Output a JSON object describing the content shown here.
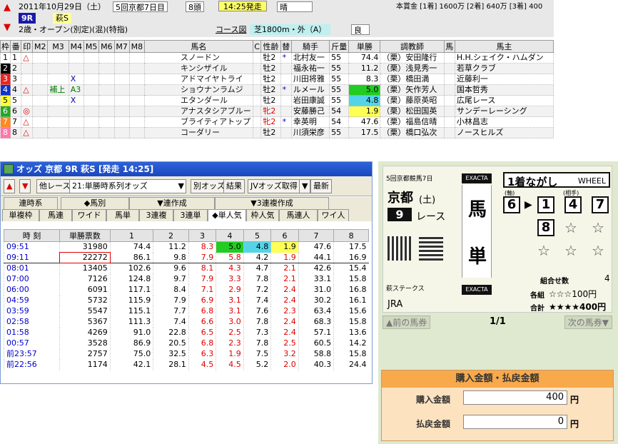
{
  "header": {
    "date": "2011年10月29日（土）",
    "meeting": "5回京都7日目",
    "runners": "8頭",
    "start_time": "14:25発走",
    "weather": "晴",
    "race_no": "9R",
    "race_name": "萩S",
    "conditions": "2歳・オープン(別定)(混)(特指)",
    "course_label": "コース図",
    "course": "芝1800m・外（A）",
    "going": "良",
    "prize": "本賞金 [1着] 1600万 [2着] 640万 [3着] 400"
  },
  "entries": {
    "columns": [
      "枠",
      "番",
      "印",
      "M2",
      "M3",
      "M4",
      "M5",
      "M6",
      "M7",
      "M8",
      "馬名",
      "C",
      "性齢",
      "替",
      "騎手",
      "斤量",
      "単勝",
      "調教師",
      "馬",
      "馬主"
    ],
    "rows": [
      {
        "waku": "1",
        "waku_color": "#ffffff",
        "waku_text": "#000000",
        "no": "1",
        "mark": "△",
        "m2": "",
        "m3": "",
        "m4": "",
        "m5": "",
        "m6": "",
        "name": "スノードン",
        "sex": "牡2",
        "sex_f": false,
        "sw": "*",
        "jockey": "北村友一",
        "kin": "55",
        "odds": "74.4",
        "odds_bg": "",
        "trainer": "（栗）安田隆行",
        "owner": "H.H.シェイク・ハムダン"
      },
      {
        "waku": "2",
        "waku_color": "#000000",
        "waku_text": "#ffffff",
        "no": "2",
        "mark": "",
        "m2": "",
        "m3": "",
        "m4": "",
        "m5": "",
        "m6": "",
        "name": "キンシザイル",
        "sex": "牡2",
        "sex_f": false,
        "sw": "",
        "jockey": "福永祐一",
        "kin": "55",
        "odds": "11.2",
        "odds_bg": "",
        "trainer": "（栗）浅見秀一",
        "owner": "若草クラブ"
      },
      {
        "waku": "3",
        "waku_color": "#ee2222",
        "waku_text": "#ffffff",
        "no": "3",
        "mark": "",
        "m2": "",
        "m3": "",
        "m4": "X",
        "m5": "",
        "m6": "",
        "name": "アドマイヤトライ",
        "sex": "牡2",
        "sex_f": false,
        "sw": "",
        "jockey": "川田将雅",
        "kin": "55",
        "odds": "8.3",
        "odds_bg": "",
        "trainer": "（栗）橋田満",
        "owner": "近藤利一"
      },
      {
        "waku": "4",
        "waku_color": "#1133cc",
        "waku_text": "#ffffff",
        "no": "4",
        "mark": "△",
        "m2": "",
        "m3": "補上",
        "m4": "A3",
        "m5": "",
        "m6": "",
        "name": "ショウナンラムジ",
        "sex": "牡2",
        "sex_f": false,
        "sw": "*",
        "jockey": "ルメール",
        "kin": "55",
        "odds": "5.0",
        "odds_bg": "#22cc22",
        "trainer": "（栗）矢作芳人",
        "owner": "国本哲秀"
      },
      {
        "waku": "5",
        "waku_color": "#ffff33",
        "waku_text": "#000000",
        "no": "5",
        "mark": "",
        "m2": "",
        "m3": "",
        "m4": "X",
        "m5": "",
        "m6": "",
        "name": "エタンダール",
        "sex": "牡2",
        "sex_f": false,
        "sw": "",
        "jockey": "岩田康誠",
        "kin": "55",
        "odds": "4.8",
        "odds_bg": "#55d4e8",
        "trainer": "（栗）藤原英昭",
        "owner": "広尾レース"
      },
      {
        "waku": "6",
        "waku_color": "#22aa22",
        "waku_text": "#ffffff",
        "no": "6",
        "mark": "◎",
        "m2": "",
        "m3": "",
        "m4": "",
        "m5": "",
        "m6": "",
        "name": "アナスタシアブルー",
        "sex": "牝2",
        "sex_f": true,
        "sw": "",
        "jockey": "安藤勝己",
        "kin": "54",
        "odds": "1.9",
        "odds_bg": "#ffff55",
        "trainer": "（栗）松田国英",
        "owner": "サンデーレーシング"
      },
      {
        "waku": "7",
        "waku_color": "#ff8822",
        "waku_text": "#ffffff",
        "no": "7",
        "mark": "△",
        "m2": "",
        "m3": "",
        "m4": "",
        "m5": "",
        "m6": "",
        "name": "ブライティアトップ",
        "sex": "牝2",
        "sex_f": true,
        "sw": "*",
        "jockey": "幸英明",
        "kin": "54",
        "odds": "47.6",
        "odds_bg": "",
        "trainer": "（栗）福島信晴",
        "owner": "小林昌志"
      },
      {
        "waku": "8",
        "waku_color": "#ff77aa",
        "waku_text": "#ffffff",
        "no": "8",
        "mark": "△",
        "m2": "",
        "m3": "",
        "m4": "",
        "m5": "",
        "m6": "",
        "name": "コーダリー",
        "sex": "牡2",
        "sex_f": false,
        "sw": "",
        "jockey": "川須栄彦",
        "kin": "55",
        "odds": "17.5",
        "odds_bg": "",
        "trainer": "（栗）橋口弘次",
        "owner": "ノースヒルズ"
      }
    ]
  },
  "odds_window": {
    "title": "オッズ 京都 9R 萩S [発走 14:25]",
    "toolbar": {
      "other_race": "他レース",
      "select": "21:単勝時系列オッズ",
      "btn1": "別オッズ",
      "btn2": "結果",
      "btn3": "JVオッズ取得",
      "btn4": "最新"
    },
    "tabs1": [
      "連時系",
      "◆馬別",
      "▼連作成",
      "▼3連複作成"
    ],
    "tabs2": [
      "単複枠",
      "馬連",
      "ワイド",
      "馬単",
      "3連複",
      "3連単",
      "◆単人気",
      "枠人気",
      "馬連人",
      "ワイ人"
    ],
    "columns": [
      "時 刻",
      "単勝票数",
      "1",
      "2",
      "3",
      "4",
      "5",
      "6",
      "7",
      "8"
    ],
    "rows": [
      [
        "09:51",
        "31980",
        "74.4",
        "11.2",
        "8.3",
        "5.0",
        "4.8",
        "1.9",
        "47.6",
        "17.5"
      ],
      [
        "09:11",
        "22272",
        "86.1",
        "9.8",
        "7.9",
        "5.8",
        "4.2",
        "1.9",
        "44.1",
        "16.9"
      ],
      [
        "08:01",
        "13405",
        "102.6",
        "9.6",
        "8.1",
        "4.3",
        "4.7",
        "2.1",
        "42.6",
        "15.4"
      ],
      [
        "07:00",
        "7126",
        "124.8",
        "9.7",
        "7.9",
        "3.3",
        "7.8",
        "2.1",
        "33.1",
        "15.8"
      ],
      [
        "06:00",
        "6091",
        "117.1",
        "8.4",
        "7.1",
        "2.9",
        "7.2",
        "2.4",
        "31.0",
        "16.8"
      ],
      [
        "04:59",
        "5732",
        "115.9",
        "7.9",
        "6.9",
        "3.1",
        "7.4",
        "2.4",
        "30.2",
        "16.1"
      ],
      [
        "03:59",
        "5547",
        "115.1",
        "7.7",
        "6.8",
        "3.1",
        "7.6",
        "2.3",
        "63.4",
        "15.6"
      ],
      [
        "02:58",
        "5367",
        "111.3",
        "7.4",
        "6.6",
        "3.0",
        "7.8",
        "2.4",
        "68.3",
        "15.8"
      ],
      [
        "01:58",
        "4269",
        "91.0",
        "22.8",
        "6.5",
        "2.5",
        "7.3",
        "2.4",
        "57.1",
        "13.6"
      ],
      [
        "00:57",
        "3528",
        "86.9",
        "20.5",
        "6.8",
        "2.3",
        "7.8",
        "2.5",
        "60.5",
        "14.2"
      ],
      [
        "前23:57",
        "2757",
        "75.0",
        "32.5",
        "6.3",
        "1.9",
        "7.5",
        "3.2",
        "58.8",
        "15.8"
      ],
      [
        "前22:56",
        "1174",
        "42.1",
        "28.1",
        "4.5",
        "4.5",
        "5.2",
        "2.0",
        "40.3",
        "24.4"
      ]
    ]
  },
  "ticket": {
    "meeting": "5回京都競馬7日",
    "venue": "京都",
    "day": "(土)",
    "race_no": "9",
    "race_label": "レース",
    "exacta_tag": "EXACTA",
    "bet_type_1": "馬",
    "bet_type_2": "単",
    "mode": "1着ながし",
    "mode_en": "WHEEL",
    "axis_label": "(軸)",
    "partner_label": "(相手)",
    "axis": "6",
    "partners": [
      "1",
      "4",
      "7",
      "8"
    ],
    "race_name": "萩ステークス",
    "jra": "JRA",
    "combos_label": "組合せ数",
    "combos": "4",
    "each_label": "各組",
    "each_value": "☆☆☆100円",
    "total_label": "合計",
    "total_value": "★★★★400円",
    "prev": "前の馬券",
    "page": "1/1",
    "next": "次の馬券",
    "pay_title": "購入金額・払戻金額",
    "buy_label": "購入金額",
    "buy_value": "400",
    "refund_label": "払戻金額",
    "refund_value": "0",
    "yen": "円"
  }
}
